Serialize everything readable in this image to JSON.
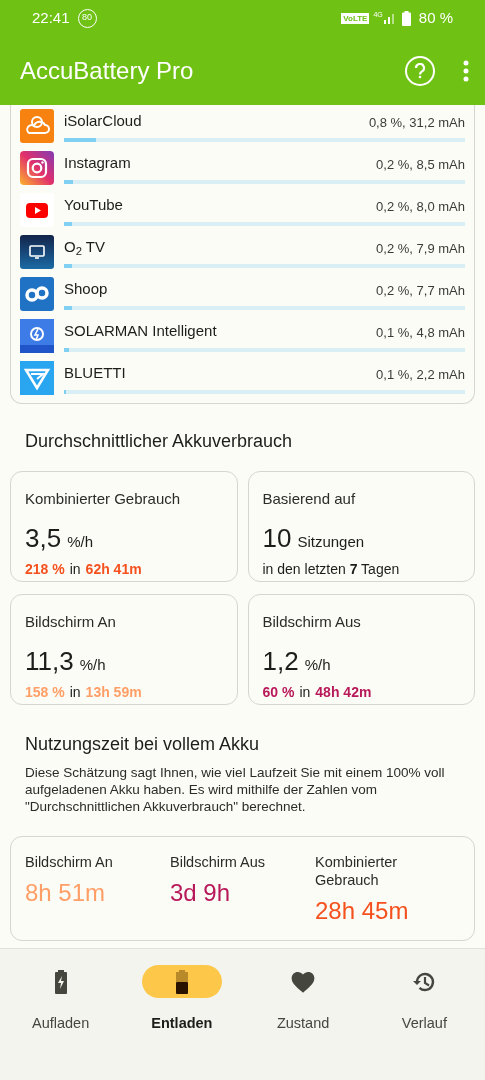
{
  "status_bar": {
    "time": "22:41",
    "notification_badge": "80",
    "volte": "VoLTE",
    "network": "4G",
    "battery": "80 %"
  },
  "app_bar": {
    "title": "AccuBattery Pro"
  },
  "apps": [
    {
      "name": "iSolarCloud",
      "usage": "0,8 %, 31,2 mAh",
      "level": 0.08,
      "kind": "solar"
    },
    {
      "name": "Instagram",
      "usage": "0,2 %, 8,5 mAh",
      "level": 0.022,
      "kind": "camera"
    },
    {
      "name": "YouTube",
      "usage": "0,2 %, 8,0 mAh",
      "level": 0.02,
      "kind": "play"
    },
    {
      "name": "O$_{2}$ TV",
      "usage": "0,2 %, 7,9 mAh",
      "level": 0.02,
      "kind": "tv"
    },
    {
      "name": "Shoop",
      "usage": "0,2 %, 7,7 mAh",
      "level": 0.02,
      "kind": "loop"
    },
    {
      "name": "SOLARMAN Intelligent",
      "usage": "0,1 %, 4,8 mAh",
      "level": 0.012,
      "kind": "bolt"
    },
    {
      "name": "BLUETTI",
      "usage": "0,1 %, 2,2 mAh",
      "level": 0.005,
      "kind": "triangle"
    }
  ],
  "average": {
    "title": "Durchschnittlicher Akkuverbrauch",
    "cards": [
      {
        "kind": "rate",
        "label": "Kombinierter Gebrauch",
        "value": "3,5",
        "unit": "%/h",
        "percent": "218 %",
        "joiner": "in",
        "duration": "62h 41m",
        "color": "#f4511e"
      },
      {
        "kind": "sessions",
        "label": "Basierend auf",
        "value": "10",
        "unit": "Sitzungen",
        "detail": "in den letzten **7** Tagen"
      },
      {
        "kind": "rate",
        "label": "Bildschirm An",
        "value": "11,3",
        "unit": "%/h",
        "percent": "158 %",
        "joiner": "in",
        "duration": "13h 59m",
        "color": "#ff9e66"
      },
      {
        "kind": "rate",
        "label": "Bildschirm Aus",
        "value": "1,2",
        "unit": "%/h",
        "percent": "60 %",
        "joiner": "in",
        "duration": "48h 42m",
        "color": "#b8195a"
      }
    ]
  },
  "full_charge": {
    "title": "Nutzungszeit bei vollem Akku",
    "description": "Diese Schätzung sagt Ihnen, wie viel Laufzeit Sie mit einem 100% voll aufgeladenen Akku haben. Es wird mithilfe der Zahlen vom \"Durchschnittlichen Akkuverbrauch\" berechnet.",
    "items": [
      {
        "label": "Bildschirm An",
        "value": "8h 51m",
        "color": "#ff9e66"
      },
      {
        "label": "Bildschirm Aus",
        "value": "3d 9h",
        "color": "#b8195a"
      },
      {
        "label": "Kombinierter Gebrauch",
        "value": "28h 45m",
        "color": "#f4511e"
      }
    ]
  },
  "bottom_nav": [
    {
      "label": "Aufladen",
      "kind": "charging",
      "selected": false
    },
    {
      "label": "Entladen",
      "kind": "discharging",
      "selected": true
    },
    {
      "label": "Zustand",
      "kind": "health",
      "selected": false
    },
    {
      "label": "Verlauf",
      "kind": "history",
      "selected": false
    }
  ]
}
